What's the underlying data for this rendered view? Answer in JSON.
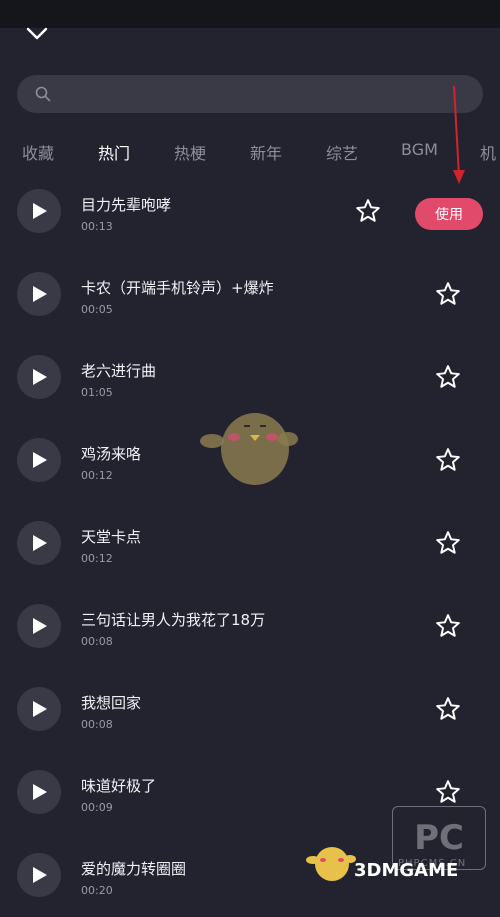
{
  "search": {
    "placeholder": ""
  },
  "tabs": [
    {
      "label": "收藏",
      "active": false
    },
    {
      "label": "热门",
      "active": true
    },
    {
      "label": "热梗",
      "active": false
    },
    {
      "label": "新年",
      "active": false
    },
    {
      "label": "综艺",
      "active": false
    },
    {
      "label": "BGM",
      "active": false
    },
    {
      "label": "机",
      "active": false
    }
  ],
  "songs": [
    {
      "title": "目力先辈咆哮",
      "duration": "00:13"
    },
    {
      "title": "卡农（开端手机铃声）+爆炸",
      "duration": "00:05"
    },
    {
      "title": "老六进行曲",
      "duration": "01:05"
    },
    {
      "title": "鸡汤来咯",
      "duration": "00:12"
    },
    {
      "title": "天堂卡点",
      "duration": "00:12"
    },
    {
      "title": "三句话让男人为我花了18万",
      "duration": "00:08"
    },
    {
      "title": "我想回家",
      "duration": "00:08"
    },
    {
      "title": "味道好极了",
      "duration": "00:09"
    },
    {
      "title": "爱的魔力转圈圈",
      "duration": "00:20"
    }
  ],
  "use_button": {
    "label": "使用"
  },
  "watermark": {
    "pc": "PC",
    "pc_site": "PHPCMS.CN",
    "brand": "3DMGAME"
  },
  "colors": {
    "background": "#232330",
    "accent": "#e24a6b",
    "arrow": "#d2232a"
  }
}
